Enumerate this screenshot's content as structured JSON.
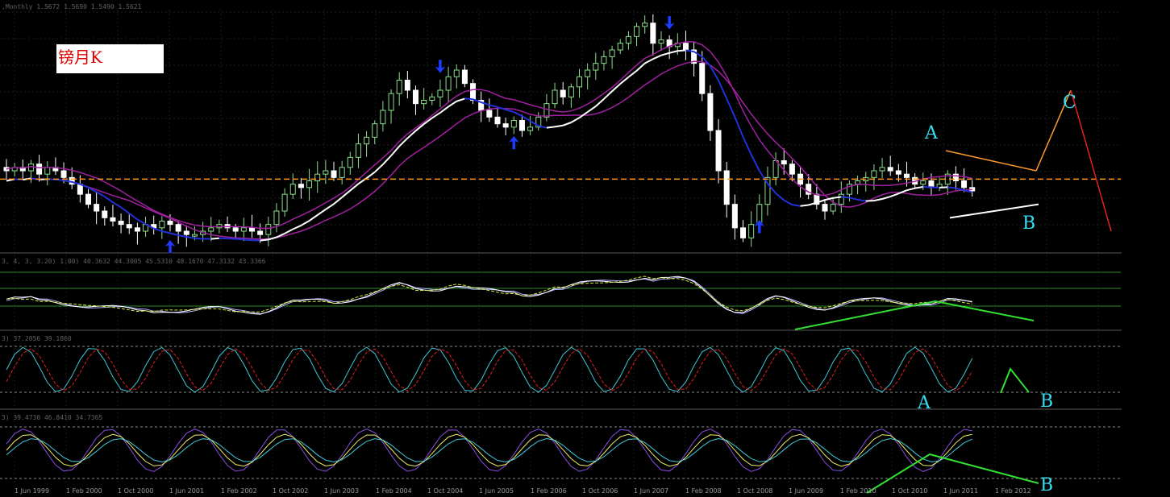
{
  "window": {
    "symbol_header": ",Monthly  1.5672 1.5690 1.5490 1.5621",
    "title_box": "镑月K"
  },
  "panels": {
    "macd_header": "3, 4, 3, 3.20) 1.00) 40.3632 44.3005 45.5310 48.1670 47.3132 43.3366",
    "stoch_header": "3) 37.2056 39.1860",
    "rsi_header": "3) 39.4730 46.8410 34.7365"
  },
  "colors": {
    "background": "#000000",
    "bull_candle": "#8be08b",
    "bear_candle": "#ffffff",
    "ma_white": "#ffffff",
    "ma_blue": "#2230d8",
    "ma_purple": "#a020a0",
    "support_line": "#ff9a1a",
    "arrow": "#1e3cff",
    "projection_orange": "#ff9a30",
    "projection_red": "#e02020",
    "divergence_green": "#33e033",
    "label_cyan": "#33e0f0"
  },
  "annotations": {
    "main_a": "A",
    "main_b": "B",
    "main_c": "C",
    "stoch_b": "B",
    "rsi_a": "A",
    "rsi_b": "B"
  },
  "chart_data": {
    "type": "candlestick",
    "timeframe": "Monthly",
    "x_tick_labels": [
      "1 Jun 1999",
      "1 Feb 2000",
      "1 Oct 2000",
      "1 Jun 2001",
      "1 Feb 2002",
      "1 Oct 2002",
      "1 Jun 2003",
      "1 Feb 2004",
      "1 Oct 2004",
      "1 Jun 2005",
      "1 Feb 2006",
      "1 Oct 2006",
      "1 Jun 2007",
      "1 Feb 2008",
      "1 Oct 2008",
      "1 Jun 2009",
      "1 Feb 2010",
      "1 Oct 2010",
      "1 Jun 2011",
      "1 Feb 2012"
    ],
    "close_path": [
      1.62,
      1.63,
      1.62,
      1.64,
      1.61,
      1.63,
      1.62,
      1.6,
      1.58,
      1.55,
      1.52,
      1.5,
      1.48,
      1.47,
      1.46,
      1.45,
      1.44,
      1.46,
      1.45,
      1.47,
      1.46,
      1.44,
      1.43,
      1.43,
      1.44,
      1.45,
      1.46,
      1.45,
      1.44,
      1.45,
      1.44,
      1.43,
      1.46,
      1.5,
      1.55,
      1.58,
      1.57,
      1.59,
      1.61,
      1.62,
      1.6,
      1.63,
      1.66,
      1.7,
      1.72,
      1.76,
      1.8,
      1.85,
      1.89,
      1.86,
      1.82,
      1.83,
      1.84,
      1.86,
      1.9,
      1.92,
      1.88,
      1.83,
      1.8,
      1.78,
      1.76,
      1.75,
      1.77,
      1.74,
      1.75,
      1.78,
      1.82,
      1.86,
      1.84,
      1.87,
      1.9,
      1.92,
      1.94,
      1.96,
      1.98,
      2.0,
      2.02,
      2.05,
      2.06,
      2.0,
      2.01,
      1.99,
      2.0,
      1.98,
      1.94,
      1.85,
      1.74,
      1.62,
      1.52,
      1.45,
      1.42,
      1.46,
      1.52,
      1.6,
      1.65,
      1.64,
      1.61,
      1.58,
      1.55,
      1.52,
      1.5,
      1.52,
      1.55,
      1.58,
      1.59,
      1.6,
      1.62,
      1.63,
      1.62,
      1.61,
      1.6,
      1.58,
      1.59,
      1.57,
      1.58,
      1.61,
      1.59,
      1.57,
      1.56
    ],
    "price_levels": {
      "support_dashed": 1.595
    },
    "ma_white_offset": -0.03,
    "ma_blue_offset": -0.03,
    "turning_points": {
      "up_arrows": [
        "2001",
        "2005",
        "2008"
      ],
      "down_arrows": [
        "2004",
        "2007"
      ]
    },
    "projection": {
      "A": 1.68,
      "B": 1.48,
      "C": 1.86,
      "end": 1.54
    },
    "indicators": {
      "macd_levels": [
        1,
        0,
        -1
      ],
      "stoch_levels": [
        80,
        20
      ],
      "rsi_levels": [
        70,
        30
      ]
    }
  }
}
